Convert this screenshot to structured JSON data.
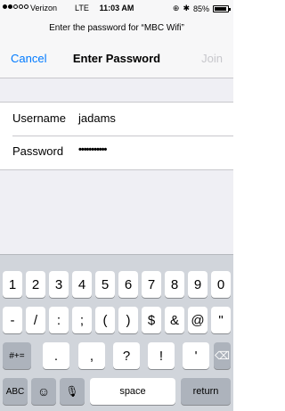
{
  "status_bar": {
    "carrier": "Verizon",
    "network": "LTE",
    "time": "11:03 AM",
    "battery": "85%"
  },
  "prompt": "Enter the password for “MBC Wifi”",
  "nav": {
    "cancel": "Cancel",
    "title": "Enter Password",
    "join": "Join"
  },
  "form": {
    "username_label": "Username",
    "username_value": "jadams",
    "password_label": "Password",
    "password_value": "•••••••••••"
  },
  "keyboard": {
    "row1": [
      "1",
      "2",
      "3",
      "4",
      "5",
      "6",
      "7",
      "8",
      "9",
      "0"
    ],
    "row2": [
      "-",
      "/",
      ":",
      ";",
      "(",
      ")",
      "$",
      "&",
      "@",
      "\""
    ],
    "row3": [
      "#+=",
      ".",
      ",",
      "?",
      "!",
      "'"
    ],
    "row4": {
      "abc": "ABC",
      "space": "space",
      "return": "return"
    }
  }
}
